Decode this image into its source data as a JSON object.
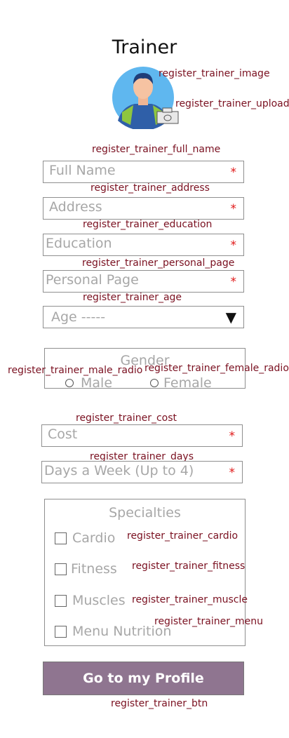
{
  "header": {
    "title": "Trainer"
  },
  "avatar": {
    "image_label": "register_trainer_image",
    "upload_label": "register_trainer_upload"
  },
  "full_name": {
    "id": "register_trainer_full_name",
    "placeholder": "Full Name",
    "required": "*"
  },
  "address": {
    "id": "register_trainer_address",
    "placeholder": "Address",
    "required": "*"
  },
  "education": {
    "id": "register_trainer_education",
    "placeholder": "Education",
    "required": "*"
  },
  "personal_page": {
    "id": "register_trainer_personal_page",
    "placeholder": "Personal Page",
    "required": "*"
  },
  "age": {
    "id": "register_trainer_age",
    "placeholder": "Age -----",
    "arrow": "▼"
  },
  "gender": {
    "title": "Gender",
    "male": {
      "id": "register_trainer_male_radio",
      "label": "Male"
    },
    "female": {
      "id": "register_trainer_female_radio",
      "label": "Female"
    }
  },
  "cost": {
    "id": "register_trainer_cost",
    "placeholder": "Cost",
    "required": "*"
  },
  "days": {
    "id": "register_trainer_days",
    "placeholder": "Days a Week (Up to 4)",
    "required": "*"
  },
  "specialties": {
    "title": "Specialties",
    "items": [
      {
        "id": "register_trainer_cardio",
        "label": "Cardio"
      },
      {
        "id": "register_trainer_fitness",
        "label": "Fitness"
      },
      {
        "id": "register_trainer_muscle",
        "label": "Muscles"
      },
      {
        "id": "register_trainer_menu",
        "label": "Menu Nutrition"
      }
    ]
  },
  "submit": {
    "id": "register_trainer_btn",
    "label": "Go to my Profile"
  },
  "colors": {
    "accent_button": "#8f7590",
    "id_label": "#7a1020",
    "required": "#e01818",
    "placeholder": "#a7a7a7"
  }
}
